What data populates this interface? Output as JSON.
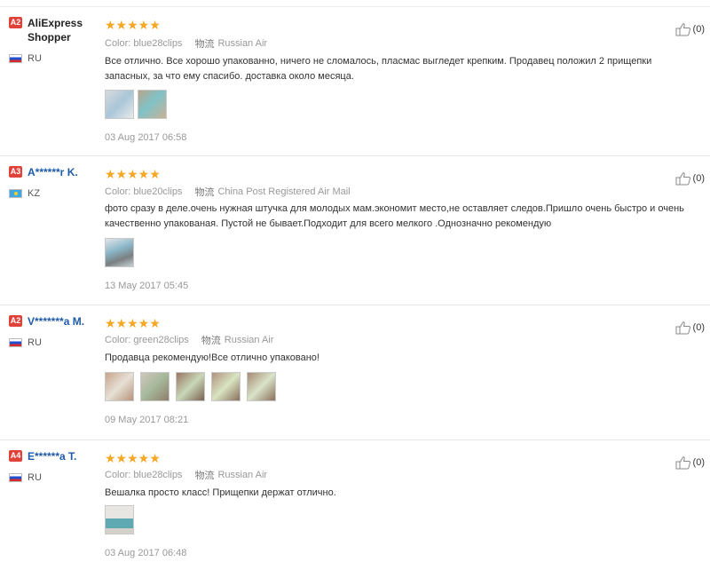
{
  "reviews": [
    {
      "level": "A2",
      "user": "AliExpress Shopper",
      "user_style": "plain",
      "country": "RU",
      "flag": "ru",
      "rating": "★★★★★",
      "color": "Color: blue28clips",
      "ship_icon": "物流",
      "shipping": "Russian Air",
      "text": "Все отлично. Все хорошо упакованно, ничего не сломалось, пласмас выгледет крепким. Продавец положил 2 прищепки запасных, за что ему спасибо. доставка около месяца.",
      "photos": 2,
      "date": "03 Aug 2017 06:58",
      "helpful": "(0)"
    },
    {
      "level": "A3",
      "user": "A******r K.",
      "user_style": "link",
      "country": "KZ",
      "flag": "kz",
      "rating": "★★★★★",
      "color": "Color: blue20clips",
      "ship_icon": "物流",
      "shipping": "China Post Registered Air Mail",
      "text": "фото сразу в деле.очень нужная штучка для молодых мам.экономит место,не оставляет следов.Пришло очень быстро и очень качественно упакованая. Пустой не бывает.Подходит для всего мелкого .Однозначно рекомендую",
      "photos": 1,
      "date": "13 May 2017 05:45",
      "helpful": "(0)"
    },
    {
      "level": "A2",
      "user": "V*******a M.",
      "user_style": "link",
      "country": "RU",
      "flag": "ru",
      "rating": "★★★★★",
      "color": "Color: green28clips",
      "ship_icon": "物流",
      "shipping": "Russian Air",
      "text": "Продавца рекомендую!Все отлично упаковано!",
      "photos": 5,
      "date": "09 May 2017 08:21",
      "helpful": "(0)"
    },
    {
      "level": "A4",
      "user": "E******a T.",
      "user_style": "link",
      "country": "RU",
      "flag": "ru",
      "rating": "★★★★★",
      "color": "Color: blue28clips",
      "ship_icon": "物流",
      "shipping": "Russian Air",
      "text": "Вешалка просто класс! Прищепки держат отлично.",
      "photos": 1,
      "date": "03 Aug 2017 06:48",
      "helpful": "(0)"
    }
  ]
}
